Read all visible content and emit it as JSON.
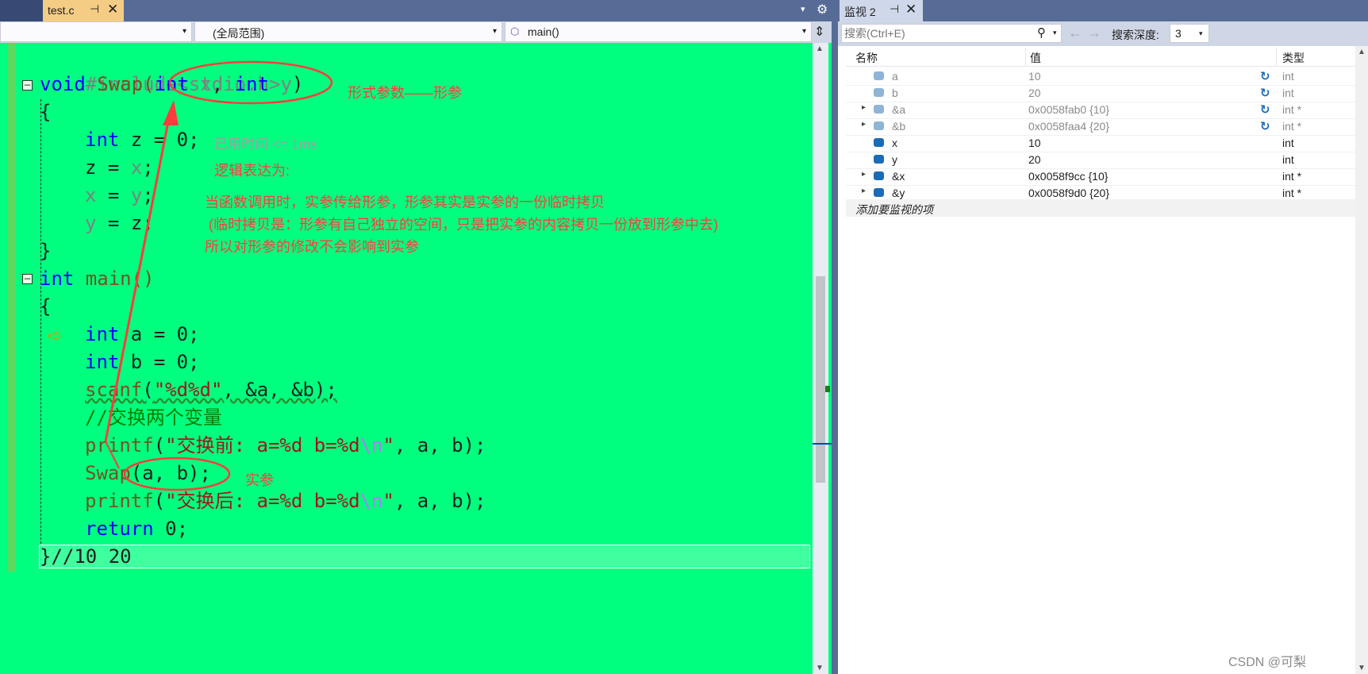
{
  "editor": {
    "tab": {
      "filename": "test.c",
      "pin_glyph": "⊣",
      "close_glyph": "✕"
    },
    "tab_overflow_glyph": "▾",
    "settings_glyph": "⚙",
    "navbar": {
      "project": "",
      "scope": "(全局范围)",
      "function": "main()",
      "dropdown_glyph": "▾",
      "split_glyph": "⇕"
    },
    "collapse_glyph": "−",
    "exec_arrow_glyph": "➪",
    "code": {
      "l1": {
        "pp": "#include<stdio.h>"
      },
      "l2": {
        "kw": "void",
        "name": " Swap(",
        "kw2": "int",
        "p1": " x",
        "sep": ", ",
        "kw3": "int",
        "p2": " y",
        "end": ")"
      },
      "l3": "{",
      "l4": {
        "kw": "int",
        "rest": " z = 0;"
      },
      "l5": {
        "a": "z = ",
        "b": "x",
        "c": ";"
      },
      "l6": {
        "a": "x",
        "b": " = ",
        "c": "y",
        "d": ";"
      },
      "l7": {
        "a": "y",
        "b": " = ",
        "c": "z",
        "d": ";"
      },
      "l8": "}",
      "l9": {
        "kw": "int",
        "rest": " main()"
      },
      "l10": "{",
      "l11": {
        "kw": "int",
        "rest": " a = 0;"
      },
      "l12": {
        "kw": "int",
        "rest": " b = 0;"
      },
      "l13": {
        "fn": "scanf",
        "p": "(",
        "s": "\"%d%d\"",
        "rest": ", &a, &b);"
      },
      "l14": "//交换两个变量",
      "l15": {
        "fn": "printf",
        "p": "(",
        "s": "\"交换前: a=%d b=%d",
        "esc": "\\n",
        "q": "\"",
        "rest": ", a, b);"
      },
      "l16": {
        "fn": "Swap",
        "rest": "(a, b);"
      },
      "l17": {
        "fn": "printf",
        "p": "(",
        "s": "\"交换后: a=%d b=%d",
        "esc": "\\n",
        "q": "\"",
        "rest": ", a, b);"
      },
      "l18": {
        "kw": "return",
        "rest": " 0;"
      },
      "l19": "}//10 20"
    },
    "annotations": {
      "formal_param": "形式参数——形参",
      "elapsed": "已用时间 <= 1ms",
      "logic_title": "逻辑表达为:",
      "line1": "当函数调用时，实参传给形参，形参其实是实参的一份临时拷贝",
      "line2": "(临时拷贝是：形参有自己独立的空间，只是把实参的内容拷贝一份放到形参中去)",
      "line3": "所以对形参的修改不会影响到实参",
      "actual_param": "实参"
    }
  },
  "watch": {
    "tab": {
      "title": "监视 2",
      "pin_glyph": "⊣",
      "close_glyph": "✕"
    },
    "search_placeholder": "搜索(Ctrl+E)",
    "search_glyph": "⚲",
    "dropdown_glyph": "▾",
    "back_glyph": "←",
    "forward_glyph": "→",
    "depth_label": "搜索深度:",
    "depth_value": "3",
    "columns": {
      "name": "名称",
      "value": "值",
      "type": "类型"
    },
    "refresh_glyph": "↻",
    "expand_glyph": "▸",
    "rows": [
      {
        "name": "a",
        "value": "10",
        "type": "int"
      },
      {
        "name": "b",
        "value": "20",
        "type": "int"
      },
      {
        "name": "&a",
        "value": "0x0058fab0 {10}",
        "type": "int *"
      },
      {
        "name": "&b",
        "value": "0x0058faa4 {20}",
        "type": "int *"
      },
      {
        "name": "x",
        "value": "10",
        "type": "int"
      },
      {
        "name": "y",
        "value": "20",
        "type": "int"
      },
      {
        "name": "&x",
        "value": "0x0058f9cc {10}",
        "type": "int *"
      },
      {
        "name": "&y",
        "value": "0x0058f9d0 {20}",
        "type": "int *"
      }
    ],
    "add_item": "添加要监视的项"
  },
  "watermark": "CSDN @可梨",
  "colors": {
    "editor_bg": "#00ff7f",
    "annotation": "#ff3c3c",
    "tab_active": "#f5cc84",
    "chrome": "#566c96"
  }
}
